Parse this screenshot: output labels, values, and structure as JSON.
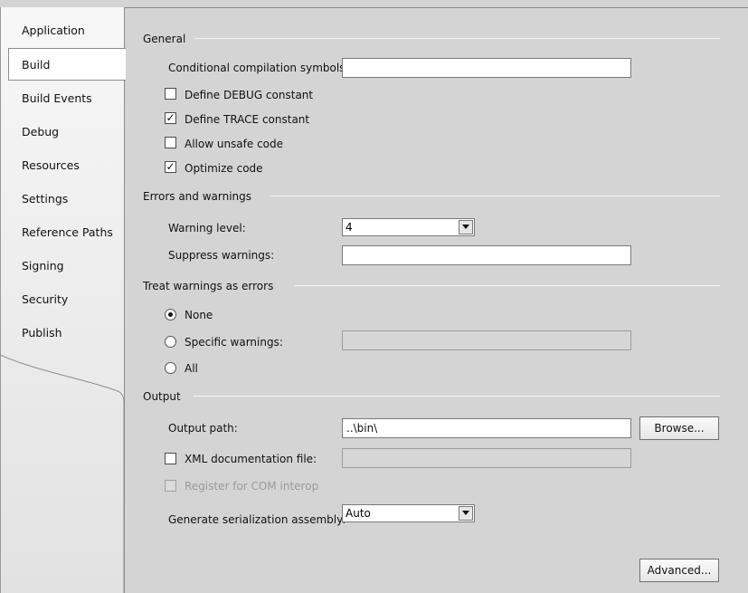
{
  "sidebar": {
    "items": [
      {
        "label": "Application"
      },
      {
        "label": "Build"
      },
      {
        "label": "Build Events"
      },
      {
        "label": "Debug"
      },
      {
        "label": "Resources"
      },
      {
        "label": "Settings"
      },
      {
        "label": "Reference Paths"
      },
      {
        "label": "Signing"
      },
      {
        "label": "Security"
      },
      {
        "label": "Publish"
      }
    ],
    "active": "Build"
  },
  "general": {
    "title": "General",
    "conditional_symbols_label": "Conditional compilation symbols:",
    "conditional_symbols_value": "",
    "define_debug": {
      "label": "Define DEBUG constant",
      "checked": false,
      "mark": ""
    },
    "define_trace": {
      "label": "Define TRACE constant",
      "checked": true,
      "mark": "✓"
    },
    "allow_unsafe": {
      "label": "Allow unsafe code",
      "checked": false,
      "mark": ""
    },
    "optimize": {
      "label": "Optimize code",
      "checked": true,
      "mark": "✓"
    }
  },
  "errors": {
    "title": "Errors and warnings",
    "warning_level_label": "Warning level:",
    "warning_level_value": "4",
    "suppress_label": "Suppress warnings:",
    "suppress_value": ""
  },
  "treat": {
    "title": "Treat warnings as errors",
    "none_label": "None",
    "specific_label": "Specific warnings:",
    "specific_value": "",
    "all_label": "All",
    "selected": "None"
  },
  "output": {
    "title": "Output",
    "path_label": "Output path:",
    "path_value": "..\\bin\\",
    "browse_label": "Browse...",
    "xml_doc": {
      "label": "XML documentation file:",
      "checked": false,
      "mark": ""
    },
    "xml_doc_value": "",
    "com_interop": {
      "label": "Register for COM interop",
      "checked": false,
      "disabled": true,
      "mark": ""
    },
    "serialization_label": "Generate serialization assembly:",
    "serialization_value": "Auto"
  },
  "advanced_label": "Advanced..."
}
